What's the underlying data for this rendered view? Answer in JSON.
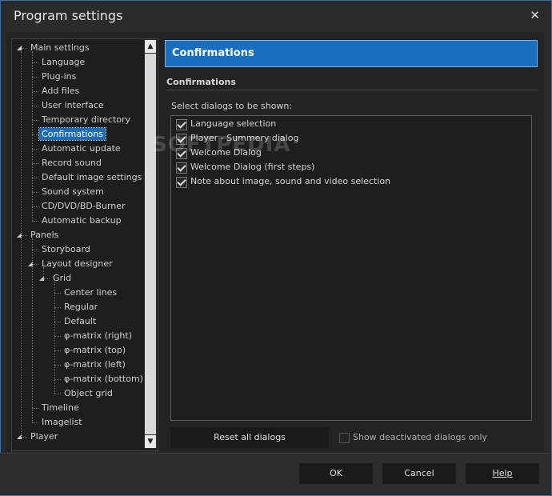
{
  "window": {
    "title": "Program settings",
    "close_glyph": "✕"
  },
  "tree": {
    "items": [
      {
        "label": "Main settings",
        "level": 0,
        "expander": "◢"
      },
      {
        "label": "Language",
        "level": 1
      },
      {
        "label": "Plug-ins",
        "level": 1
      },
      {
        "label": "Add files",
        "level": 1
      },
      {
        "label": "User interface",
        "level": 1
      },
      {
        "label": "Temporary directory",
        "level": 1
      },
      {
        "label": "Confirmations",
        "level": 1,
        "selected": true
      },
      {
        "label": "Automatic update",
        "level": 1
      },
      {
        "label": "Record sound",
        "level": 1
      },
      {
        "label": "Default image settings",
        "level": 1
      },
      {
        "label": "Sound system",
        "level": 1
      },
      {
        "label": "CD/DVD/BD-Burner",
        "level": 1
      },
      {
        "label": "Automatic backup",
        "level": 1
      },
      {
        "label": "Panels",
        "level": 0,
        "expander": "◢"
      },
      {
        "label": "Storyboard",
        "level": 1
      },
      {
        "label": "Layout designer",
        "level": 1,
        "expander": "◢"
      },
      {
        "label": "Grid",
        "level": 2,
        "expander": "◢"
      },
      {
        "label": "Center lines",
        "level": 3
      },
      {
        "label": "Regular",
        "level": 3
      },
      {
        "label": "Default",
        "level": 3
      },
      {
        "label": "φ-matrix (right)",
        "level": 3
      },
      {
        "label": "φ-matrix (top)",
        "level": 3
      },
      {
        "label": "φ-matrix (left)",
        "level": 3
      },
      {
        "label": "φ-matrix (bottom)",
        "level": 3
      },
      {
        "label": "Object grid",
        "level": 3
      },
      {
        "label": "Timeline",
        "level": 1
      },
      {
        "label": "Imagelist",
        "level": 1
      },
      {
        "label": "Player",
        "level": 0,
        "expander": "◢"
      }
    ],
    "scroll_up": "▲",
    "scroll_down": "▼"
  },
  "panel": {
    "header": "Confirmations",
    "section_title": "Confirmations",
    "list_caption": "Select dialogs to be shown:",
    "dialogs": [
      {
        "label": "Language selection",
        "checked": true
      },
      {
        "label": "Player - Summery dialog",
        "checked": true
      },
      {
        "label": "Welcome Dialog",
        "checked": true
      },
      {
        "label": "Welcome Dialog (first steps)",
        "checked": true
      },
      {
        "label": "Note about image, sound and video selection",
        "checked": true
      }
    ],
    "reset_button": "Reset all dialogs",
    "show_deactivated_label": "Show deactivated dialogs only",
    "show_deactivated_checked": false
  },
  "watermark": "SOFTPEDIA",
  "footer": {
    "ok": "OK",
    "cancel": "Cancel",
    "help": "Help"
  }
}
